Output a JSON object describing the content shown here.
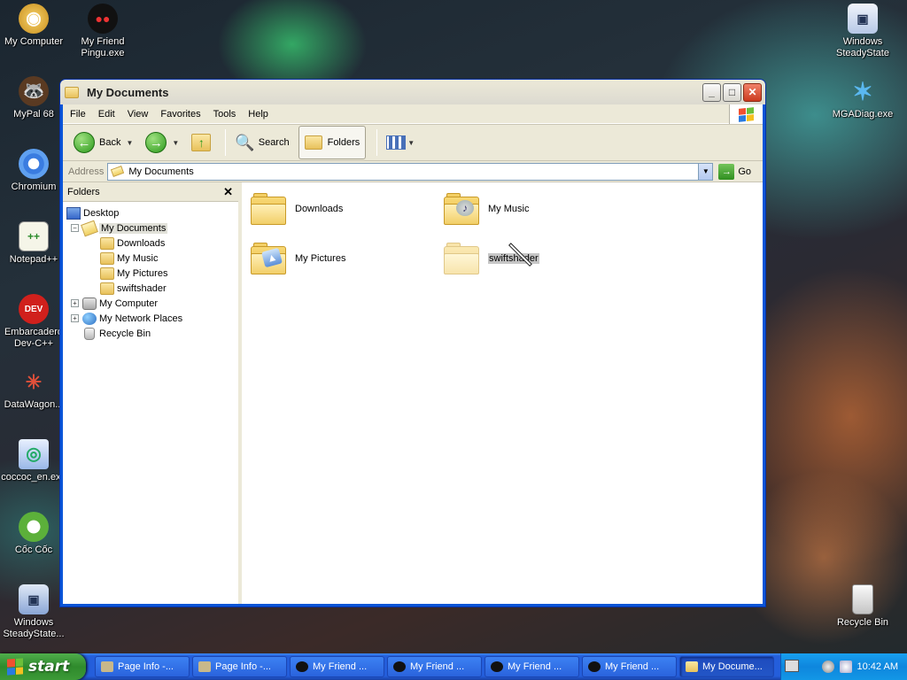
{
  "desktop": {
    "icons_left": [
      {
        "label": "My Computer",
        "icon": "my-computer-icon"
      },
      {
        "label": "My Friend Pingu.exe",
        "icon": "pingu-icon"
      },
      {
        "label": "MyPal 68",
        "icon": "mypal-icon"
      },
      {
        "label": "Chromium",
        "icon": "chromium-icon"
      },
      {
        "label": "Notepad++",
        "icon": "notepad-plus-icon"
      },
      {
        "label": "Embarcadero Dev-C++",
        "icon": "devcpp-icon"
      },
      {
        "label": "DataWagon...",
        "icon": "datawagon-icon"
      },
      {
        "label": "coccoc_en.exe",
        "icon": "coccoc-installer-icon"
      },
      {
        "label": "Cốc Cốc",
        "icon": "coccoc-icon"
      },
      {
        "label": "Windows SteadyState...",
        "icon": "steadystate-icon"
      }
    ],
    "icons_right": [
      {
        "label": "Windows SteadyState",
        "icon": "steadystate-icon"
      },
      {
        "label": "MGADiag.exe",
        "icon": "mgadiag-icon"
      },
      {
        "label": "Recycle Bin",
        "icon": "recycle-bin-icon"
      }
    ]
  },
  "window": {
    "title": "My Documents",
    "menu": [
      "File",
      "Edit",
      "View",
      "Favorites",
      "Tools",
      "Help"
    ],
    "toolbar": {
      "back": "Back",
      "search": "Search",
      "folders": "Folders"
    },
    "address": {
      "label": "Address",
      "value": "My Documents",
      "go": "Go"
    },
    "tree": {
      "header": "Folders",
      "close": "✕",
      "items": [
        {
          "label": "Desktop"
        },
        {
          "label": "My Documents"
        },
        {
          "label": "Downloads"
        },
        {
          "label": "My Music"
        },
        {
          "label": "My Pictures"
        },
        {
          "label": "swiftshader"
        },
        {
          "label": "My Computer"
        },
        {
          "label": "My Network Places"
        },
        {
          "label": "Recycle Bin"
        }
      ]
    },
    "content": {
      "items": [
        {
          "label": "Downloads"
        },
        {
          "label": "My Music"
        },
        {
          "label": "My Pictures"
        },
        {
          "label": "swiftshader"
        }
      ]
    }
  },
  "taskbar": {
    "start": "start",
    "tasks": [
      {
        "label": "Page Info -..."
      },
      {
        "label": "Page Info -..."
      },
      {
        "label": "My Friend ..."
      },
      {
        "label": "My Friend ..."
      },
      {
        "label": "My Friend ..."
      },
      {
        "label": "My Friend ..."
      },
      {
        "label": "My Docume..."
      }
    ],
    "clock": "10:42 AM"
  }
}
